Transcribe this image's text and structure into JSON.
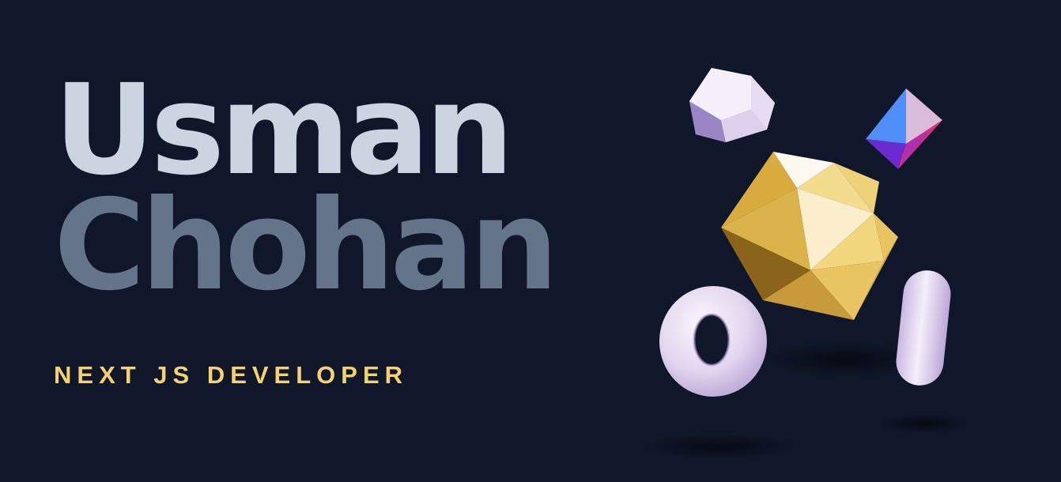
{
  "hero": {
    "first_name": "Usman",
    "last_name": "Chohan",
    "role": "NEXT JS DEVELOPER"
  },
  "scene": {
    "shapes": [
      {
        "name": "dodecahedron-shape",
        "color": "#e9def1"
      },
      {
        "name": "octahedron-shape",
        "color": "#4f8ef7"
      },
      {
        "name": "icosahedron-shape",
        "color": "#e8b94a"
      },
      {
        "name": "torus-shape",
        "color": "#e2d6f0"
      },
      {
        "name": "capsule-shape",
        "color": "#e2d6f0"
      }
    ]
  },
  "colors": {
    "background": "#10172a",
    "first_name": "#cbd5e1",
    "last_name": "#64748b",
    "role": "#f5d26b"
  }
}
